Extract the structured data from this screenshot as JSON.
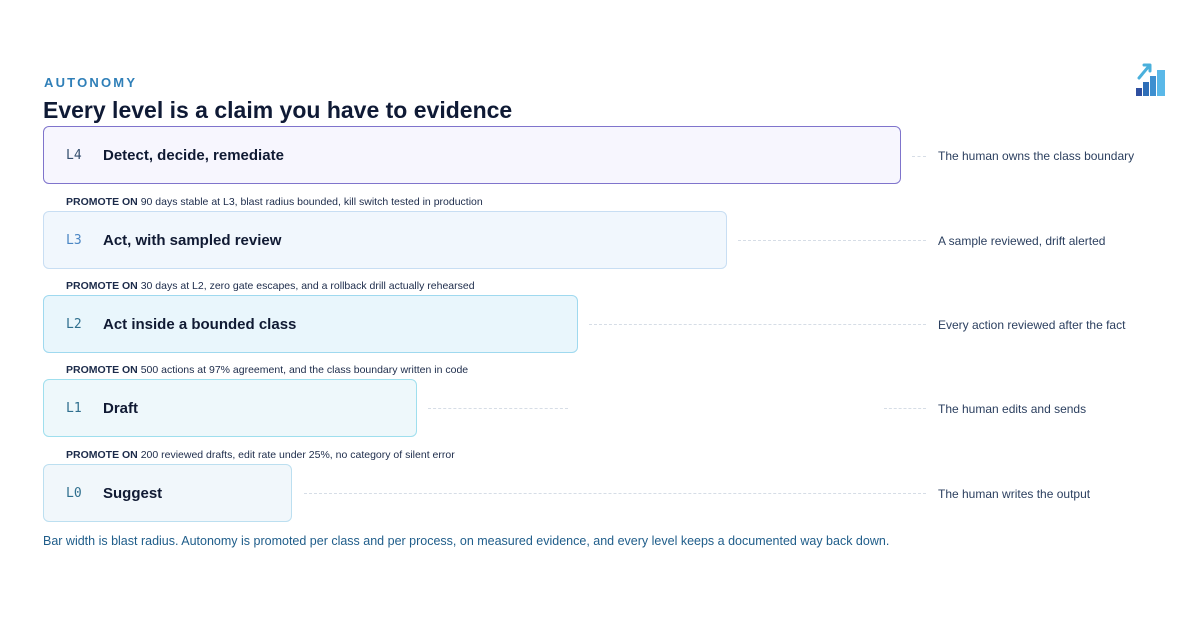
{
  "header": {
    "eyebrow": "AUTONOMY",
    "title": "Every level is a claim you have to evidence",
    "logo": "bar-chart-arrow-icon"
  },
  "levels": [
    {
      "code": "L4",
      "name": "Detect, decide, remediate",
      "note": "The human owns the class boundary",
      "color": "#7f74cc"
    },
    {
      "code": "L3",
      "name": "Act, with sampled review",
      "note": "A sample reviewed, drift alerted",
      "color": "#c8def3"
    },
    {
      "code": "L2",
      "name": "Act inside a bounded class",
      "note": "Every action reviewed after the fact",
      "color": "#9fd9ef"
    },
    {
      "code": "L1",
      "name": "Draft",
      "note": "The human edits and sends",
      "color": "#9fdfee"
    },
    {
      "code": "L0",
      "name": "Suggest",
      "note": "The human writes the output",
      "color": "#bcdff0"
    }
  ],
  "promotions": [
    {
      "label": "PROMOTE ON",
      "text": "90 days stable at L3, blast radius bounded, kill switch tested in production"
    },
    {
      "label": "PROMOTE ON",
      "text": "30 days at L2, zero gate escapes, and a rollback drill actually rehearsed"
    },
    {
      "label": "PROMOTE ON",
      "text": "500 actions at 97% agreement, and the class boundary written in code"
    },
    {
      "label": "PROMOTE ON",
      "text": "200 reviewed drafts, edit rate under 25%, no category of silent error"
    }
  ],
  "caption": "Bar width is blast radius. Autonomy is promoted per class and per process, on measured evidence, and every level keeps a documented way back down."
}
